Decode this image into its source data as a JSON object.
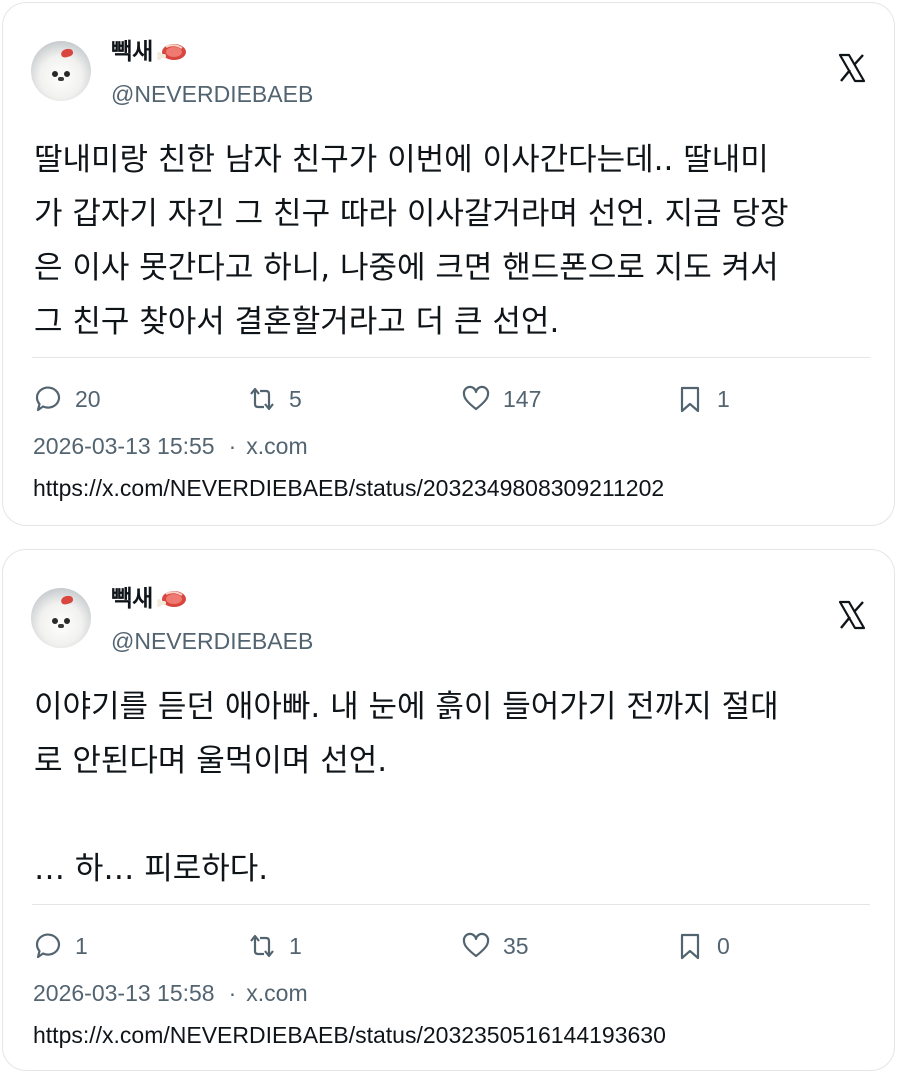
{
  "tweets": [
    {
      "display_name": "빽새",
      "name_emoji": "meat-on-bone-icon",
      "handle": "@NEVERDIEBAEB",
      "text": "딸내미랑 친한 남자 친구가 이번에 이사간다는데.. 딸내미\n가 갑자기 자긴 그 친구 따라 이사갈거라며 선언. 지금 당장\n은 이사 못간다고 하니, 나중에 크면 핸드폰으로 지도 켜서\n그 친구 찾아서 결혼할거라고 더 큰 선언.",
      "replies": "20",
      "reposts": "5",
      "likes": "147",
      "bookmarks": "1",
      "timestamp": "2026-03-13 15:55",
      "separator": "·",
      "source": "x.com",
      "url": "https://x.com/NEVERDIEBAEB/status/2032349808309211202"
    },
    {
      "display_name": "빽새",
      "name_emoji": "meat-on-bone-icon",
      "handle": "@NEVERDIEBAEB",
      "text": "이야기를 듣던 애아빠. 내 눈에 흙이 들어가기 전까지 절대\n로 안된다며 울먹이며 선언.\n\n… 하… 피로하다.",
      "replies": "1",
      "reposts": "1",
      "likes": "35",
      "bookmarks": "0",
      "timestamp": "2026-03-13 15:58",
      "separator": "·",
      "source": "x.com",
      "url": "https://x.com/NEVERDIEBAEB/status/2032350516144193630"
    }
  ],
  "colors": {
    "text": "#0f1419",
    "secondary": "#536471",
    "border": "#e3e6e9",
    "meat": "#d9463f"
  }
}
